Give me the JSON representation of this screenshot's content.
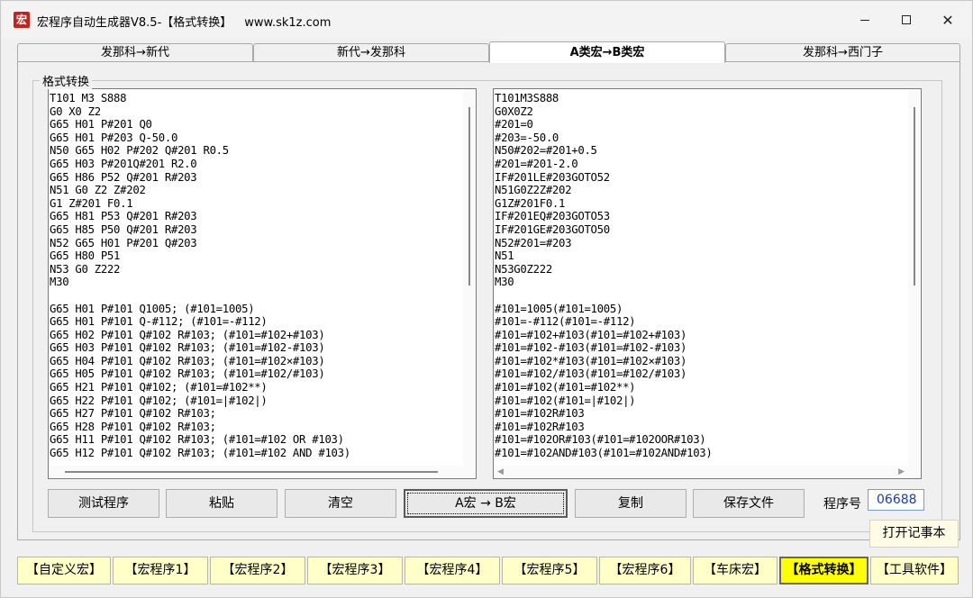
{
  "window": {
    "title": "宏程序自动生成器V8.5-【格式转换】",
    "url": "www.sk1z.com",
    "icon_char": "宏"
  },
  "tabs": [
    {
      "label": "发那科→新代",
      "active": false
    },
    {
      "label": "新代→发那科",
      "active": false
    },
    {
      "label": "A类宏→B类宏",
      "active": true
    },
    {
      "label": "发那科→西门子",
      "active": false
    }
  ],
  "group": {
    "legend": "格式转换"
  },
  "left_code": [
    "T101 M3 S888",
    "G0 X0 Z2",
    "G65 H01 P#201 Q0",
    "G65 H01 P#203 Q-50.0",
    "N50 G65 H02 P#202 Q#201 R0.5",
    "G65 H03 P#201Q#201 R2.0",
    "G65 H86 P52 Q#201 R#203",
    "N51 G0 Z2 Z#202",
    "G1 Z#201 F0.1",
    "G65 H81 P53 Q#201 R#203",
    "G65 H85 P50 Q#201 R#203",
    "N52 G65 H01 P#201 Q#203",
    "G65 H80 P51",
    "N53 G0 Z222",
    "M30",
    "",
    "G65 H01 P#101 Q1005; (#101=1005)",
    "G65 H01 P#101 Q-#112; (#101=-#112)",
    "G65 H02 P#101 Q#102 R#103; (#101=#102+#103)",
    "G65 H03 P#101 Q#102 R#103; (#101=#102-#103)",
    "G65 H04 P#101 Q#102 R#103; (#101=#102×#103)",
    "G65 H05 P#101 Q#102 R#103; (#101=#102/#103)",
    "G65 H21 P#101 Q#102; (#101=#102**)",
    "G65 H22 P#101 Q#102; (#101=|#102|)",
    "G65 H27 P#101 Q#102 R#103;",
    "G65 H28 P#101 Q#102 R#103;",
    "G65 H11 P#101 Q#102 R#103; (#101=#102 OR #103)",
    "G65 H12 P#101 Q#102 R#103; (#101=#102 AND #103)"
  ],
  "right_code": [
    "T101M3S888",
    "G0X0Z2",
    "#201=0",
    "#203=-50.0",
    "N50#202=#201+0.5",
    "#201=#201-2.0",
    "IF#201LE#203GOTO52",
    "N51G0Z2Z#202",
    "G1Z#201F0.1",
    "IF#201EQ#203GOTO53",
    "IF#201GE#203GOTO50",
    "N52#201=#203",
    "N51",
    "N53G0Z222",
    "M30",
    "",
    "#101=1005(#101=1005)",
    "#101=-#112(#101=-#112)",
    "#101=#102+#103(#101=#102+#103)",
    "#101=#102-#103(#101=#102-#103)",
    "#101=#102*#103(#101=#102×#103)",
    "#101=#102/#103(#101=#102/#103)",
    "#101=#102(#101=#102**)",
    "#101=#102(#101=|#102|)",
    "#101=#102R#103",
    "#101=#102R#103",
    "#101=#102OR#103(#101=#102OOR#103)",
    "#101=#102AND#103(#101=#102AND#103)"
  ],
  "buttons": {
    "test": "测试程序",
    "paste": "粘贴",
    "clear": "清空",
    "convert": "A宏 → B宏",
    "copy": "复制",
    "save": "保存文件",
    "program_no_label": "程序号",
    "program_no_value": "06688",
    "open_notepad": "打开记事本"
  },
  "bottom_bar": [
    {
      "label": "【自定义宏】",
      "active": false
    },
    {
      "label": "【宏程序1】",
      "active": false
    },
    {
      "label": "【宏程序2】",
      "active": false
    },
    {
      "label": "【宏程序3】",
      "active": false
    },
    {
      "label": "【宏程序4】",
      "active": false
    },
    {
      "label": "【宏程序5】",
      "active": false
    },
    {
      "label": "【宏程序6】",
      "active": false
    },
    {
      "label": "【车床宏】",
      "active": false
    },
    {
      "label": "【格式转换】",
      "active": true
    },
    {
      "label": "【工具软件】",
      "active": false
    }
  ],
  "colors": {
    "bottom_bar_bg": "#ffffc8",
    "bottom_bar_active": "#ffff00",
    "program_no_text": "#1a3cb4",
    "app_icon": "#c8201c"
  }
}
